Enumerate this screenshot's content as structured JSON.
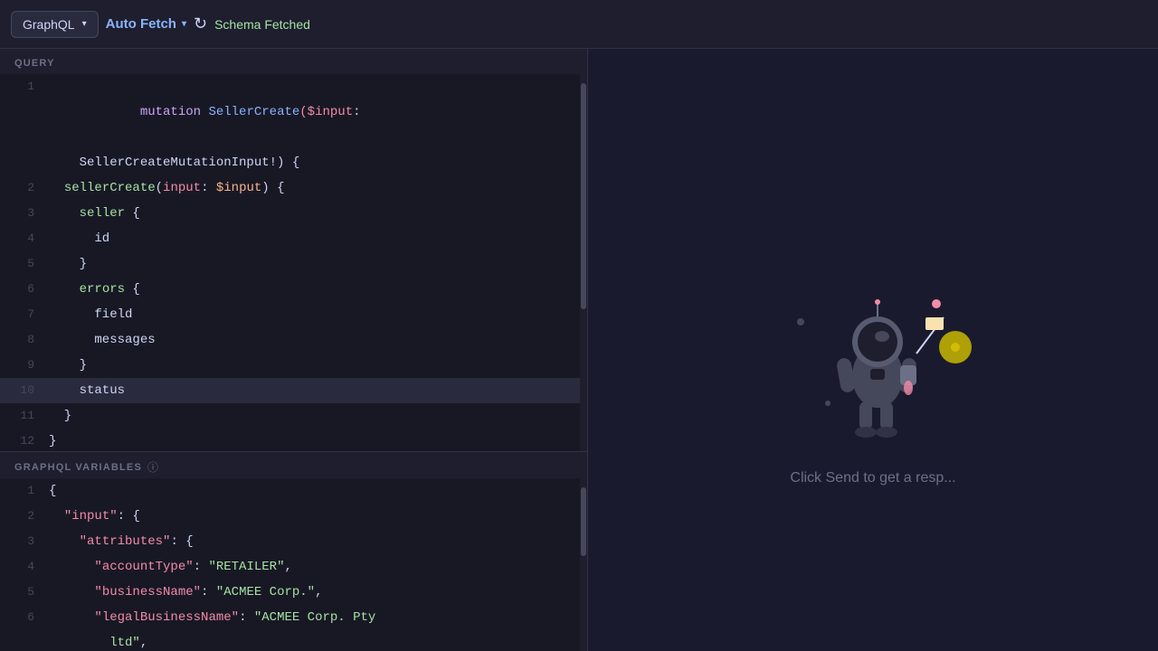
{
  "toolbar": {
    "graphql_label": "GraphQL",
    "auto_fetch_label": "Auto Fetch",
    "schema_fetched_label": "Schema Fetched"
  },
  "query_section": {
    "label": "QUERY",
    "lines": [
      {
        "num": 1,
        "parts": [
          {
            "text": "mutation ",
            "class": "kw-mutation"
          },
          {
            "text": "SellerCreate",
            "class": "kw-name"
          },
          {
            "text": "($input",
            "class": "kw-param"
          },
          {
            "text": ":",
            "class": ""
          },
          {
            "text": "",
            "class": ""
          }
        ],
        "raw": "mutation SellerCreate($input:"
      },
      {
        "num": null,
        "raw": "    SellerCreateMutationInput!) {",
        "indent": "    "
      },
      {
        "num": 2,
        "raw": "  sellerCreate(input: $input) {"
      },
      {
        "num": 3,
        "raw": "    seller {"
      },
      {
        "num": 4,
        "raw": "      id"
      },
      {
        "num": 5,
        "raw": "    }"
      },
      {
        "num": 6,
        "raw": "    errors {"
      },
      {
        "num": 7,
        "raw": "      field"
      },
      {
        "num": 8,
        "raw": "      messages"
      },
      {
        "num": 9,
        "raw": "    }"
      },
      {
        "num": 10,
        "raw": "    status",
        "highlighted": true
      },
      {
        "num": 11,
        "raw": "  }"
      },
      {
        "num": 12,
        "raw": "}"
      }
    ]
  },
  "variables_section": {
    "label": "GRAPHQL VARIABLES",
    "info_icon": "ℹ",
    "lines": [
      {
        "num": 1,
        "raw": "{"
      },
      {
        "num": 2,
        "raw": "  \"input\": {"
      },
      {
        "num": 3,
        "raw": "    \"attributes\": {"
      },
      {
        "num": 4,
        "raw": "      \"accountType\": \"RETAILER\","
      },
      {
        "num": 5,
        "raw": "      \"businessName\": \"ACMEE Corp.\","
      },
      {
        "num": 6,
        "raw": "      \"legalBusinessName\": \"ACMEE Corp. Pty"
      },
      {
        "num": null,
        "raw": "        ltd\","
      }
    ]
  },
  "right_panel": {
    "click_send_text": "Click Send to get a resp..."
  }
}
